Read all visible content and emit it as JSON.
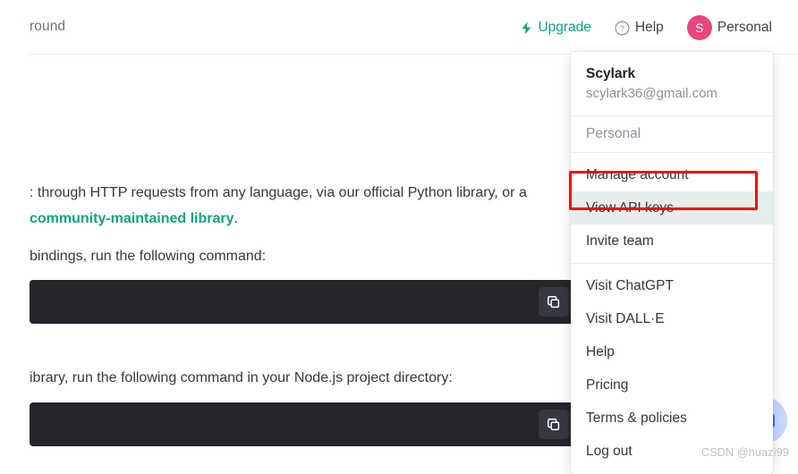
{
  "header": {
    "title": "round",
    "upgrade_label": "Upgrade",
    "upgrade_icon": "bolt-icon",
    "upgrade_color": "#10a37f",
    "help_label": "Help",
    "help_icon": "question-circle-icon",
    "avatar_initial": "S",
    "avatar_color": "#e8467c",
    "account_label": "Personal"
  },
  "content": {
    "paragraph_1_prefix": ": through HTTP requests from any language, via our official Python library, or a ",
    "paragraph_1_link": "community-maintained library",
    "paragraph_1_suffix": ".",
    "paragraph_2": "bindings, run the following command:",
    "paragraph_3": "ibrary, run the following command in your Node.js project directory:",
    "code_block_1_text": "",
    "code_block_2_text": "",
    "copy_icon": "copy-icon"
  },
  "dropdown": {
    "user_name": "Scylark",
    "user_email": "scylark36@gmail.com",
    "section_label": "Personal",
    "group_1": [
      {
        "label": "Manage account",
        "highlighted": false
      },
      {
        "label": "View API keys",
        "highlighted": true
      },
      {
        "label": "Invite team",
        "highlighted": false
      }
    ],
    "group_2": [
      {
        "label": "Visit ChatGPT",
        "highlighted": false
      },
      {
        "label": "Visit DALL·E",
        "highlighted": false
      },
      {
        "label": "Help",
        "highlighted": false
      },
      {
        "label": "Pricing",
        "highlighted": false
      },
      {
        "label": "Terms & policies",
        "highlighted": false
      },
      {
        "label": "Log out",
        "highlighted": false
      }
    ],
    "highlight_color": "#e4efed",
    "annotation_color": "#fb0007"
  },
  "chat_widget": {
    "icon": "chat-bubble-icon",
    "color": "#3b6ef5"
  },
  "watermark": {
    "text": "CSDN @huazi99"
  }
}
